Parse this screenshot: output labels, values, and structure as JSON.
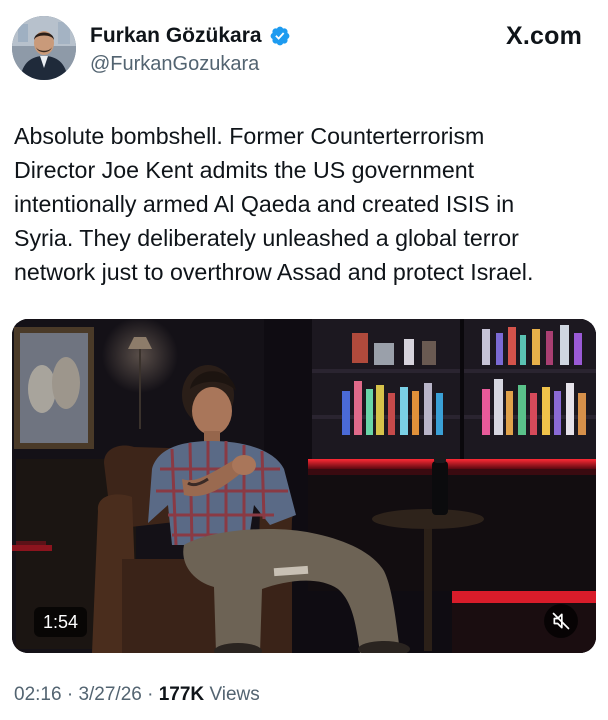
{
  "author": {
    "display_name": "Furkan Gözükara",
    "handle": "@FurkanGozukara",
    "verified": true,
    "verified_icon": "verified-badge-icon",
    "avatar": "profile-photo"
  },
  "brand": {
    "logo_text": "X.com"
  },
  "tweet": {
    "lines": [
      "Absolute bombshell. Former Counterterrorism",
      "Director Joe Kent admits the US government",
      "intentionally armed Al Qaeda and created ISIS in",
      "Syria. They deliberately unleashed a global terror",
      "network just to overthrow Assad and protect Israel."
    ]
  },
  "video": {
    "duration": "1:54",
    "mute_icon": "speaker-muted-icon",
    "accent_colors": {
      "shelf_glow": "#e11d2a",
      "overlay_bg": "#000000"
    }
  },
  "meta": {
    "time": "02:16",
    "separator": "·",
    "date": "3/27/26",
    "views_count": "177K",
    "views_label": "Views"
  },
  "colors": {
    "text_primary": "#0f1419",
    "text_secondary": "#536471",
    "verified_blue": "#1d9bf0"
  }
}
